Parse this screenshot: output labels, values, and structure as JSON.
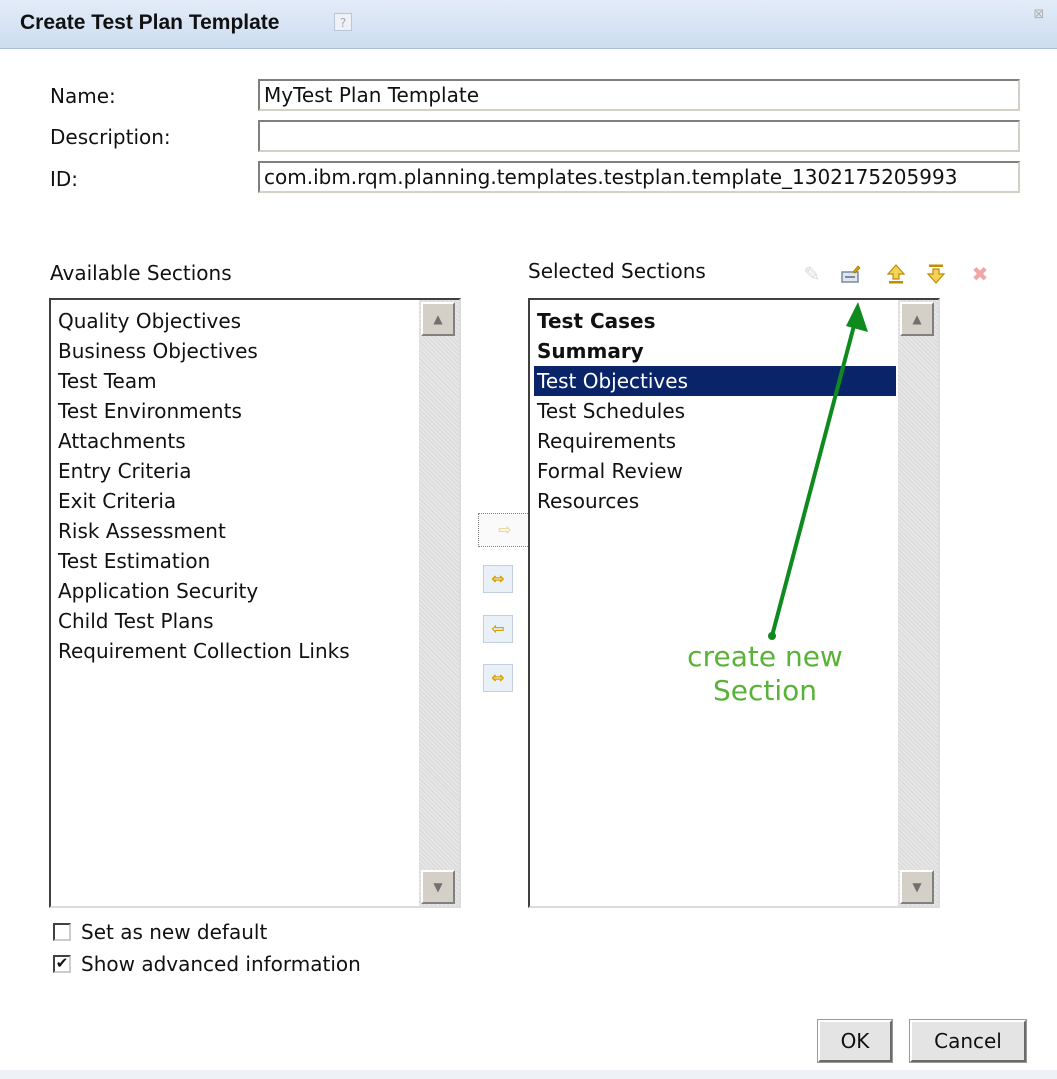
{
  "dialog": {
    "title": "Create Test Plan Template",
    "help_icon": "?",
    "close_icon": "⊠"
  },
  "form": {
    "name_label": "Name:",
    "name_value": "MyTest Plan Template",
    "description_label": "Description:",
    "description_value": "",
    "id_label": "ID:",
    "id_value": "com.ibm.rqm.planning.templates.testplan.template_1302175205993"
  },
  "available": {
    "heading": "Available Sections",
    "items": [
      "Quality Objectives",
      "Business Objectives",
      "Test Team",
      "Test Environments",
      "Attachments",
      "Entry Criteria",
      "Exit Criteria",
      "Risk Assessment",
      "Test Estimation",
      "Application Security",
      "Child Test Plans",
      "Requirement Collection Links"
    ]
  },
  "selected": {
    "heading": "Selected Sections",
    "items": [
      "Test Cases",
      "Summary",
      "Test Objectives",
      "Test Schedules",
      "Requirements",
      "Formal Review",
      "Resources"
    ],
    "bold_items": [
      "Test Cases",
      "Summary"
    ],
    "highlighted_item": "Test Objectives"
  },
  "icons": {
    "edit": "pencil-icon",
    "new_section": "new-section-icon",
    "move_up": "move-up-icon",
    "move_down": "move-down-icon",
    "delete": "delete-icon",
    "add": "arrow-right-icon",
    "add_all": "double-arrow-right-icon",
    "remove": "arrow-left-icon",
    "remove_all": "double-arrow-left-icon"
  },
  "options": {
    "set_default_label": "Set as new default",
    "set_default_checked": false,
    "show_advanced_label": "Show advanced information",
    "show_advanced_checked": true
  },
  "buttons": {
    "ok": "OK",
    "cancel": "Cancel"
  },
  "annotation": {
    "line1": "create new",
    "line2": "Section",
    "color": "#5ab238",
    "arrow_color": "#0f8a1e"
  },
  "colors": {
    "title_bar": "#cddcf0",
    "selection": "#0a246a"
  }
}
